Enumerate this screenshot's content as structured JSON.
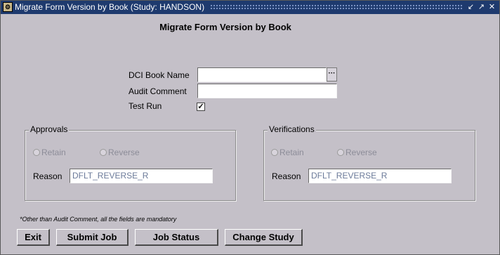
{
  "window": {
    "title": "Migrate Form Version by Book (Study: HANDSON)",
    "controls": [
      "↙",
      "↗",
      "✕"
    ]
  },
  "form": {
    "heading": "Migrate Form Version by Book",
    "dci_book_name_label": "DCI Book Name",
    "dci_book_name_value": "",
    "lov_button_label": "···",
    "audit_comment_label": "Audit Comment",
    "audit_comment_value": "",
    "test_run_label": "Test Run",
    "test_run_checked": true,
    "test_run_mark": "✓"
  },
  "approvals": {
    "title": "Approvals",
    "retain_label": "Retain",
    "reverse_label": "Reverse",
    "reason_label": "Reason",
    "reason_value": "DFLT_REVERSE_R"
  },
  "verifications": {
    "title": "Verifications",
    "retain_label": "Retain",
    "reverse_label": "Reverse",
    "reason_label": "Reason",
    "reason_value": "DFLT_REVERSE_R"
  },
  "note": "*Other than Audit Comment, all the fields are mandatory",
  "buttons": {
    "exit": "Exit",
    "submit_job": "Submit Job",
    "job_status": "Job Status",
    "change_study": "Change Study"
  },
  "colors": {
    "titlebar": "#1e3a6e",
    "background": "#c4c0c8",
    "disabled_text": "#8c8c98"
  }
}
